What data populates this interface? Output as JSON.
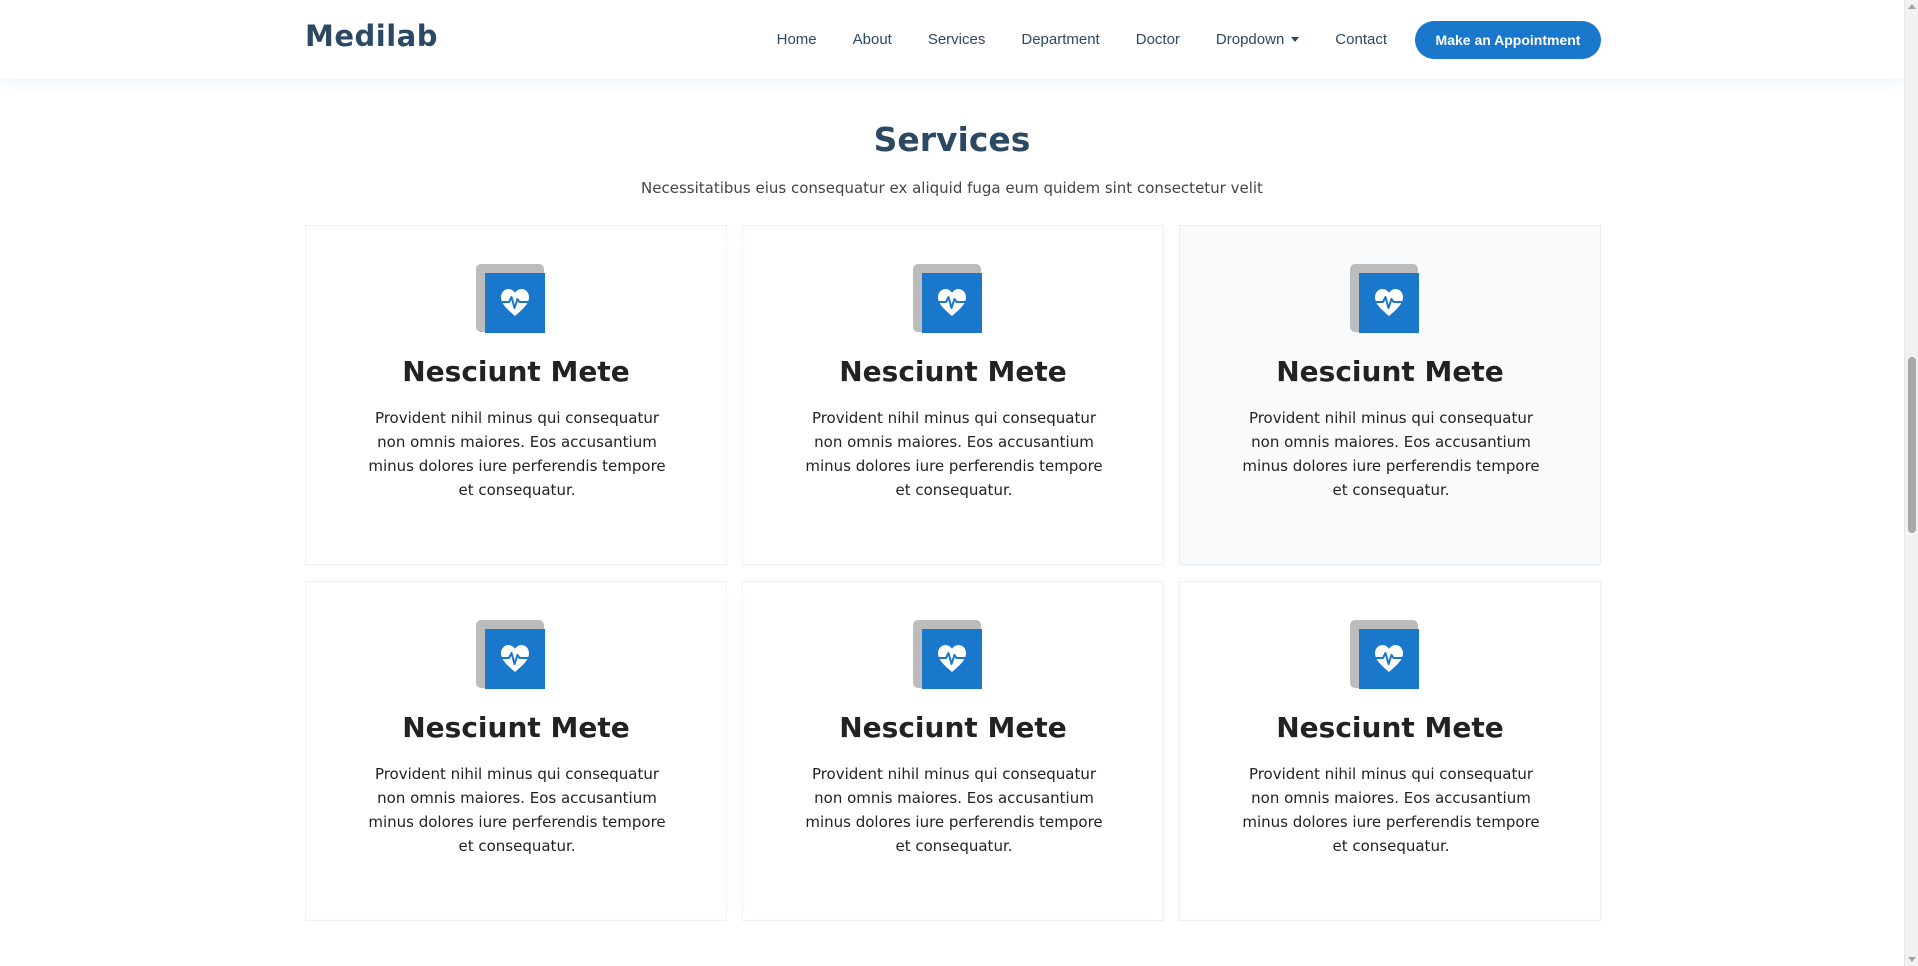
{
  "header": {
    "logo": "Medilab",
    "nav": [
      {
        "label": "Home"
      },
      {
        "label": "About"
      },
      {
        "label": "Services"
      },
      {
        "label": "Department"
      },
      {
        "label": "Doctor"
      },
      {
        "label": "Dropdown",
        "has_caret": true
      },
      {
        "label": "Contact"
      }
    ],
    "cta_label": "Make an Appointment"
  },
  "section": {
    "title": "Services",
    "subtitle": "Necessitatibus eius consequatur ex aliquid fuga eum quidem sint consectetur velit"
  },
  "cards": [
    {
      "icon": "heartbeat-icon",
      "title": "Nesciunt Mete",
      "description": "Provident nihil minus qui consequatur non omnis maiores. Eos accusantium minus dolores iure perferendis tempore et consequatur."
    },
    {
      "icon": "heartbeat-icon",
      "title": "Nesciunt Mete",
      "description": "Provident nihil minus qui consequatur non omnis maiores. Eos accusantium minus dolores iure perferendis tempore et consequatur."
    },
    {
      "icon": "heartbeat-icon",
      "title": "Nesciunt Mete",
      "description": "Provident nihil minus qui consequatur non omnis maiores. Eos accusantium minus dolores iure perferendis tempore et consequatur."
    },
    {
      "icon": "heartbeat-icon",
      "title": "Nesciunt Mete",
      "description": "Provident nihil minus qui consequatur non omnis maiores. Eos accusantium minus dolores iure perferendis tempore et consequatur."
    },
    {
      "icon": "heartbeat-icon",
      "title": "Nesciunt Mete",
      "description": "Provident nihil minus qui consequatur non omnis maiores. Eos accusantium minus dolores iure perferendis tempore et consequatur."
    },
    {
      "icon": "heartbeat-icon",
      "title": "Nesciunt Mete",
      "description": "Provident nihil minus qui consequatur non omnis maiores. Eos accusantium minus dolores iure perferendis tempore et consequatur."
    }
  ],
  "colors": {
    "primary": "#1977cc",
    "heading": "#2c4964",
    "icon_shadow": "#bcbcbc"
  }
}
